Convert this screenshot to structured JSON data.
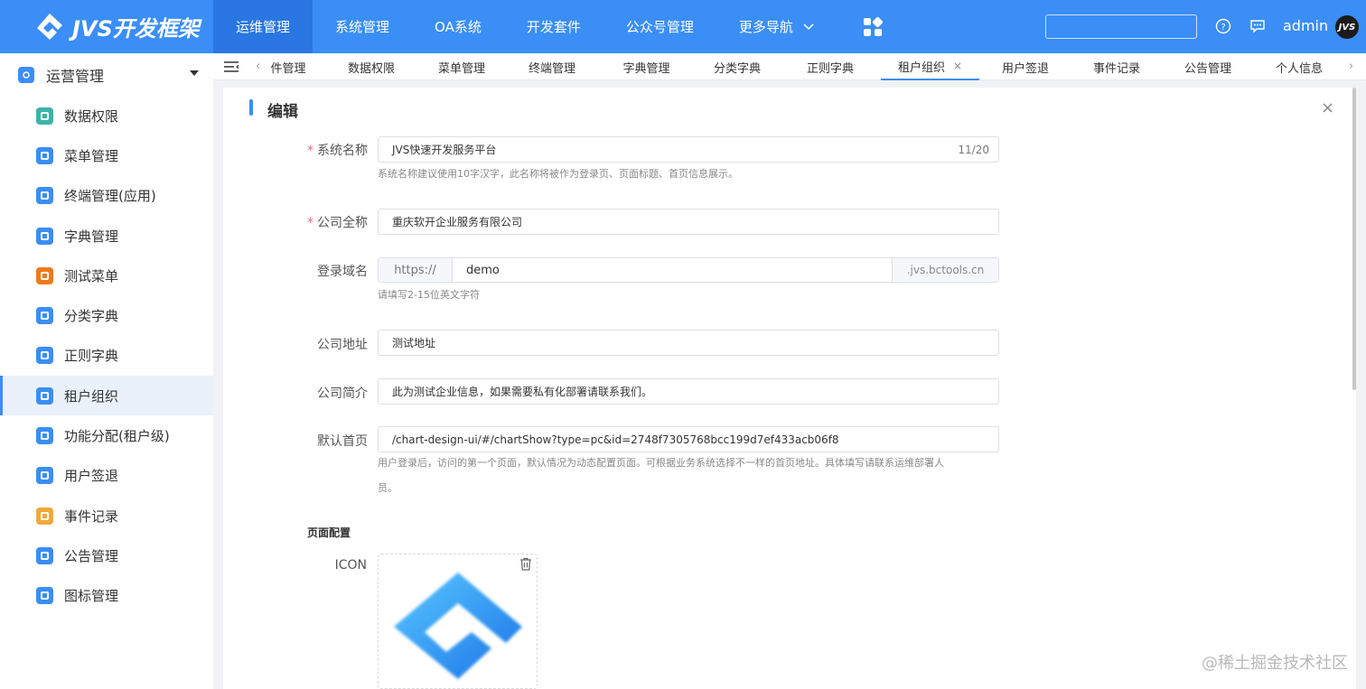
{
  "brand": {
    "name": "JVS开发框架"
  },
  "topnav": {
    "items": [
      {
        "label": "运维管理",
        "active": true
      },
      {
        "label": "系统管理"
      },
      {
        "label": "OA系统"
      },
      {
        "label": "开发套件"
      },
      {
        "label": "公众号管理"
      },
      {
        "label": "更多导航"
      }
    ],
    "user": "admin",
    "avatar_text": "JVS"
  },
  "sidebar": {
    "group": "运营管理",
    "items": [
      {
        "label": "数据权限",
        "color": "#3bb4a8"
      },
      {
        "label": "菜单管理",
        "color": "#3a8ef6"
      },
      {
        "label": "终端管理(应用)",
        "color": "#3a8ef6"
      },
      {
        "label": "字典管理",
        "color": "#3a8ef6"
      },
      {
        "label": "测试菜单",
        "color": "#f07a1a"
      },
      {
        "label": "分类字典",
        "color": "#3a8ef6"
      },
      {
        "label": "正则字典",
        "color": "#3a8ef6"
      },
      {
        "label": "租户组织",
        "color": "#3a8ef6",
        "active": true
      },
      {
        "label": "功能分配(租户级)",
        "color": "#3a8ef6"
      },
      {
        "label": "用户签退",
        "color": "#3a8ef6"
      },
      {
        "label": "事件记录",
        "color": "#f0a93a"
      },
      {
        "label": "公告管理",
        "color": "#3a8ef6"
      },
      {
        "label": "图标管理",
        "color": "#3a8ef6"
      }
    ]
  },
  "tabs": [
    {
      "label": "件管理"
    },
    {
      "label": "数据权限"
    },
    {
      "label": "菜单管理"
    },
    {
      "label": "终端管理"
    },
    {
      "label": "字典管理"
    },
    {
      "label": "分类字典"
    },
    {
      "label": "正则字典"
    },
    {
      "label": "租户组织",
      "active": true,
      "close": "×"
    },
    {
      "label": "用户签退"
    },
    {
      "label": "事件记录"
    },
    {
      "label": "公告管理"
    },
    {
      "label": "个人信息"
    }
  ],
  "form": {
    "title": "编辑",
    "system_name": {
      "label": "系统名称",
      "value": "JVS快速开发服务平台",
      "counter": "11/20",
      "hint": "系统名称建议使用10字汉字，此名称将被作为登录页、页面标题、首页信息展示。"
    },
    "company_name": {
      "label": "公司全称",
      "value": "重庆软开企业服务有限公司"
    },
    "domain": {
      "label": "登录域名",
      "prefix": "https://",
      "value": "demo",
      "suffix": ".jvs.bctools.cn",
      "hint": "请填写2-15位英文字符"
    },
    "address": {
      "label": "公司地址",
      "value": "测试地址"
    },
    "intro": {
      "label": "公司简介",
      "value": "此为测试企业信息，如果需要私有化部署请联系我们。"
    },
    "home": {
      "label": "默认首页",
      "value": "/chart-design-ui/#/chartShow?type=pc&id=2748f7305768bcc199d7ef433acb06f8",
      "hint_line1": "用户登录后，访问的第一个页面，默认情况为动态配置页面。可根据业务系统选择不一样的首页地址。具体填写请联系运维部署人",
      "hint_line2": "员。"
    },
    "page_config_label": "页面配置",
    "icon_label": "ICON"
  },
  "watermark": "@稀土掘金技术社区"
}
